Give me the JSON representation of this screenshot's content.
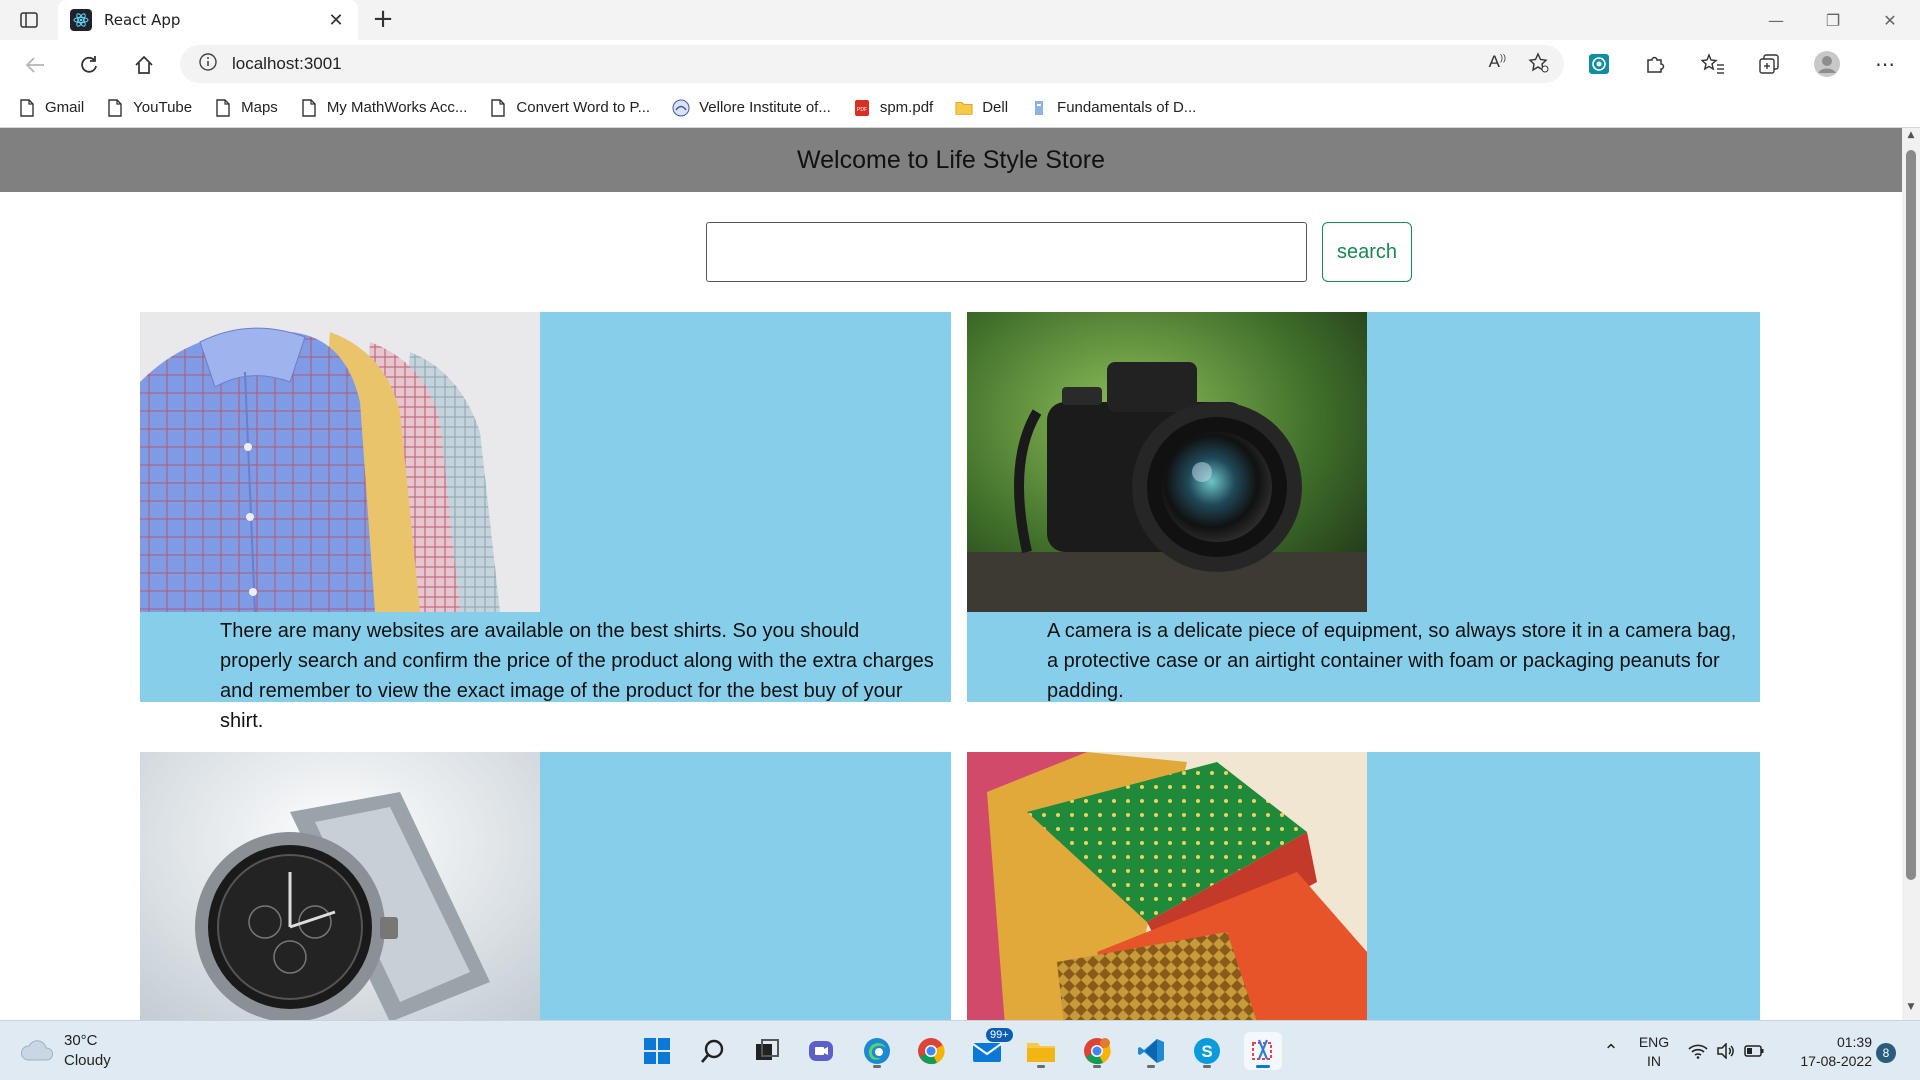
{
  "browser": {
    "tab_title": "React App",
    "url": "localhost:3001",
    "bookmarks": [
      {
        "label": "Gmail",
        "icon": "page-icon"
      },
      {
        "label": "YouTube",
        "icon": "page-icon"
      },
      {
        "label": "Maps",
        "icon": "page-icon"
      },
      {
        "label": "My MathWorks Acc...",
        "icon": "page-icon"
      },
      {
        "label": "Convert Word to P...",
        "icon": "page-icon"
      },
      {
        "label": "Vellore Institute of...",
        "icon": "vit-icon"
      },
      {
        "label": "spm.pdf",
        "icon": "pdf-icon"
      },
      {
        "label": "Dell",
        "icon": "folder-icon"
      },
      {
        "label": "Fundamentals of D...",
        "icon": "book-icon"
      }
    ]
  },
  "page": {
    "header_title": "Welcome to Life Style Store",
    "search": {
      "value": "",
      "placeholder": "",
      "button_label": "search"
    },
    "products": [
      {
        "image": "shirts-photo",
        "description": "There are many websites are available on the best shirts. So you should properly search and confirm the price of the product along with the extra charges and remember to view the exact image of the product for the best buy of your shirt."
      },
      {
        "image": "camera-photo",
        "description": "A camera is a delicate piece of equipment, so always store it in a camera bag, a protective case or an airtight container with foam or packaging peanuts for padding."
      },
      {
        "image": "watch-photo",
        "description": ""
      },
      {
        "image": "sarees-photo",
        "description": ""
      }
    ],
    "card_color": "#87ceeb",
    "header_color": "#808080",
    "button_color": "#198754"
  },
  "taskbar": {
    "weather_temp": "30°C",
    "weather_desc": "Cloudy",
    "mail_badge": "99+",
    "lang_top": "ENG",
    "lang_bottom": "IN",
    "time": "01:39",
    "date": "17-08-2022",
    "notification_count": "8"
  }
}
